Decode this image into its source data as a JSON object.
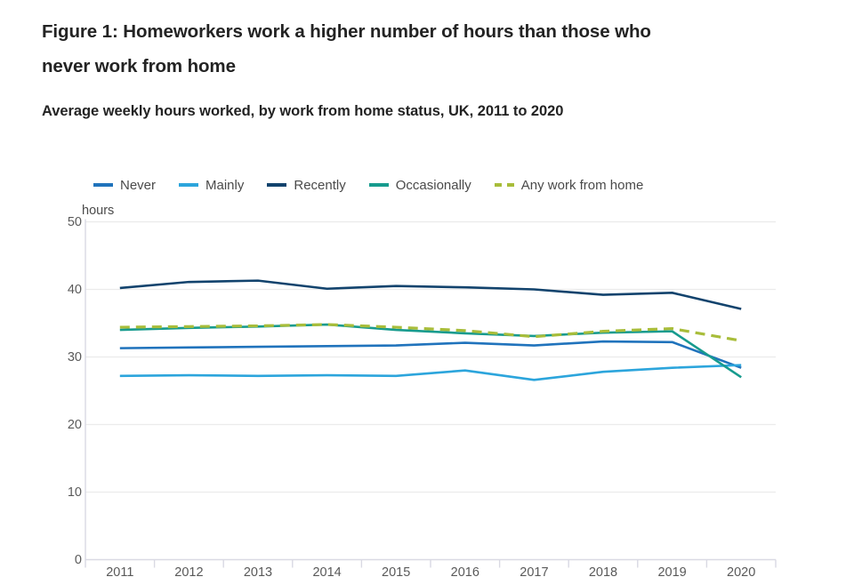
{
  "figure": {
    "title": "Figure 1: Homeworkers work a higher number of hours than those who never work from home",
    "subtitle": "Average weekly hours worked, by work from home status, UK, 2011 to 2020",
    "unit_label": "hours"
  },
  "colors": {
    "never": "#2073BC",
    "mainly": "#2CA5DC",
    "recently": "#12436D",
    "occasionally": "#179B8E",
    "any_work_from_home": "#A8BD3A",
    "gridline": "#ebebeb",
    "axis": "#d9d9e3",
    "text": "#4a4a4a",
    "title_text": "#232323"
  },
  "chart_data": {
    "type": "line",
    "title": "Figure 1: Homeworkers work a higher number of hours than those who never work from home",
    "subtitle": "Average weekly hours worked, by work from home status, UK, 2011 to 2020",
    "xlabel": "",
    "ylabel": "hours",
    "ylim": [
      0,
      50
    ],
    "yticks": [
      0,
      10,
      20,
      30,
      40,
      50
    ],
    "grid": true,
    "legend_position": "top",
    "categories": [
      "2011",
      "2012",
      "2013",
      "2014",
      "2015",
      "2016",
      "2017",
      "2018",
      "2019",
      "2020"
    ],
    "series": [
      {
        "name": "Never",
        "color": "#2073BC",
        "style": "solid",
        "values": [
          31.3,
          31.4,
          31.5,
          31.6,
          31.7,
          32.1,
          31.7,
          32.3,
          32.2,
          28.4
        ]
      },
      {
        "name": "Mainly",
        "color": "#2CA5DC",
        "style": "solid",
        "values": [
          27.2,
          27.3,
          27.2,
          27.3,
          27.2,
          28.0,
          26.6,
          27.8,
          28.4,
          28.8
        ]
      },
      {
        "name": "Recently",
        "color": "#12436D",
        "style": "solid",
        "values": [
          40.2,
          41.1,
          41.3,
          40.1,
          40.5,
          40.3,
          40.0,
          39.2,
          39.5,
          37.1
        ]
      },
      {
        "name": "Occasionally",
        "color": "#179B8E",
        "style": "solid",
        "values": [
          34.0,
          34.3,
          34.5,
          34.8,
          34.0,
          33.5,
          33.1,
          33.6,
          33.8,
          27.0
        ]
      },
      {
        "name": "Any work from home",
        "color": "#A8BD3A",
        "style": "dashed",
        "values": [
          34.4,
          34.5,
          34.6,
          34.8,
          34.4,
          33.9,
          33.0,
          33.8,
          34.2,
          32.4
        ]
      }
    ]
  }
}
